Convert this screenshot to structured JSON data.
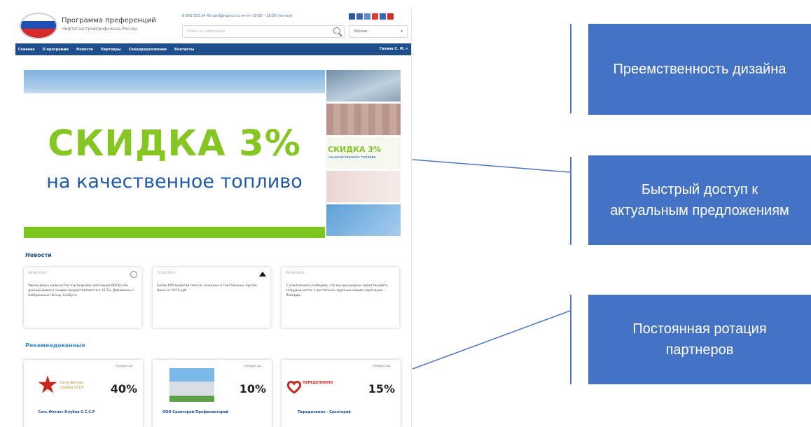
{
  "header": {
    "brand_title": "Программа преференций",
    "brand_subtitle": "Нефтегазстройпрофсоюза России",
    "contacts": "8 800 550 34 45  card@nsprus.ru  пн-пт 10:00 – 18:00 (по мск)",
    "search_placeholder": "Поиск по партнерам",
    "city": "Москва",
    "social_colors": [
      "#2a5aa6",
      "#3b65b7",
      "#5a8fd1",
      "#e03b2c",
      "#3b65b7",
      "#d62b2b"
    ]
  },
  "nav": {
    "items": [
      "Главная",
      "О программе",
      "Новости",
      "Партнеры",
      "Спецпредложения",
      "Контакты"
    ],
    "user": "Газина С. М."
  },
  "banner": {
    "headline": "СКИДКА 3%",
    "subline": "на качественное топливо"
  },
  "thumbnail": {
    "headline": "СКИДКА 3%",
    "subline": "на качественное топливо"
  },
  "news": {
    "title": "Новости",
    "cards": [
      {
        "date": "26-09-2019",
        "text": "Увеличилось количество партнерских магазинов ВОСБН На данный момент скидки предоставляются в 16 ТЦ. Добавлены г. Набережные Челны, Елабуга."
      },
      {
        "date": "22-03-2019",
        "text": "Более 900 моделей пальто, кожаных и текстильных курток. Цены от 2070 руб."
      },
      {
        "date": "06-04-2019",
        "text": "С сожалением сообщаем, что мы вынуждены приостановить сотрудничество с достаточно крупным нашим партнером – Леверди."
      }
    ]
  },
  "recommended": {
    "title": "Рекомендованные",
    "discount_label": "Скидка до",
    "cards": [
      {
        "percent": "40%",
        "name": "Сеть Фитнес Клубов С.С.С.Р",
        "logo_text": "Сеть фитнес клубов СССР"
      },
      {
        "percent": "10%",
        "name": "ООО Санаторий-Профилакторий",
        "logo_text": ""
      },
      {
        "percent": "15%",
        "name": "Переделкино - Санаторий",
        "logo_text": "ПЕРЕДЕЛКИНО"
      }
    ]
  },
  "annotations": {
    "design_continuity": "Преемственность дизайна",
    "quick_access": "Быстрый доступ к актуальным предложениям",
    "partner_rotation": "Постоянная ротация партнеров"
  },
  "colors": {
    "annotation_box": "#4472c4",
    "nav": "#1f4e8c",
    "banner_green": "#86c623",
    "banner_blue": "#1e5aa8"
  }
}
